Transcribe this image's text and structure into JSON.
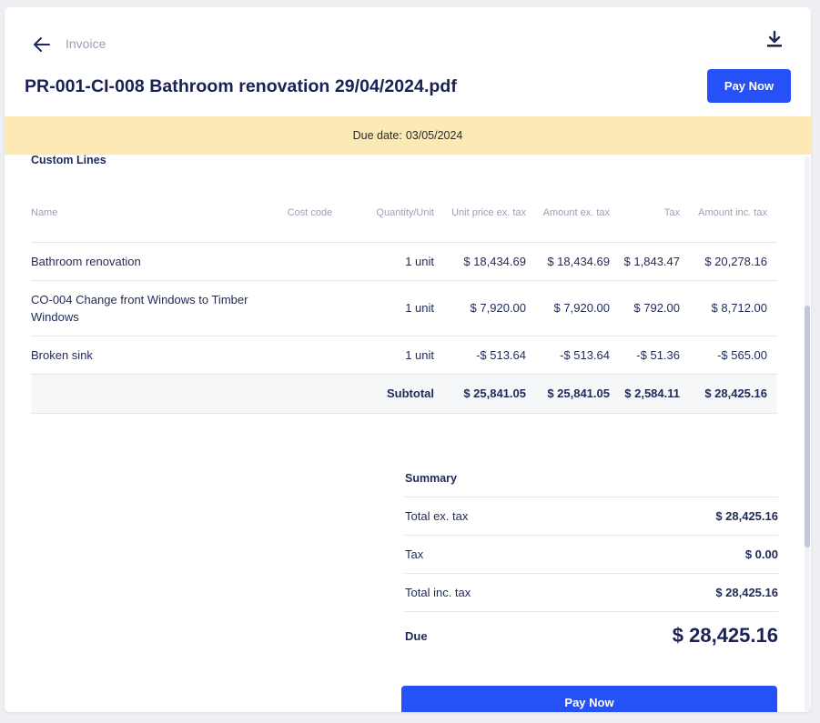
{
  "header": {
    "breadcrumb": "Invoice",
    "title": "PR-001-CI-008 Bathroom renovation 29/04/2024.pdf",
    "pay_button": "Pay Now"
  },
  "banner": {
    "label": "Due date:",
    "date": "03/05/2024",
    "color": "#fde9b3"
  },
  "accent_color": "#2651f7",
  "icons": {
    "back": "arrow-left-icon",
    "download": "download-icon"
  },
  "custom_lines": {
    "title": "Custom Lines",
    "columns": {
      "name": "Name",
      "cost_code": "Cost code",
      "quantity": "Quantity/Unit",
      "unit_price": "Unit price ex. tax",
      "amount_ex": "Amount ex. tax",
      "tax": "Tax",
      "amount_inc": "Amount inc. tax"
    },
    "rows": [
      {
        "name": "Bathroom renovation",
        "cost_code": "",
        "quantity": "1 unit",
        "unit_price": "$ 18,434.69",
        "amount_ex": "$ 18,434.69",
        "tax": "$ 1,843.47",
        "amount_inc": "$ 20,278.16"
      },
      {
        "name": "CO-004 Change front Windows to Timber Windows",
        "cost_code": "",
        "quantity": "1 unit",
        "unit_price": "$ 7,920.00",
        "amount_ex": "$ 7,920.00",
        "tax": "$ 792.00",
        "amount_inc": "$ 8,712.00"
      },
      {
        "name": "Broken sink",
        "cost_code": "",
        "quantity": "1 unit",
        "unit_price": "-$ 513.64",
        "amount_ex": "-$ 513.64",
        "tax": "-$ 51.36",
        "amount_inc": "-$ 565.00"
      }
    ],
    "subtotal": {
      "label": "Subtotal",
      "unit_price": "$ 25,841.05",
      "amount_ex": "$ 25,841.05",
      "tax": "$ 2,584.11",
      "amount_inc": "$ 28,425.16"
    }
  },
  "summary": {
    "title": "Summary",
    "total_ex_label": "Total ex. tax",
    "total_ex_value": "$ 28,425.16",
    "tax_label": "Tax",
    "tax_value": "$ 0.00",
    "total_inc_label": "Total inc. tax",
    "total_inc_value": "$ 28,425.16",
    "due_label": "Due",
    "due_value": "$ 28,425.16"
  },
  "footer": {
    "pay_button": "Pay Now"
  }
}
